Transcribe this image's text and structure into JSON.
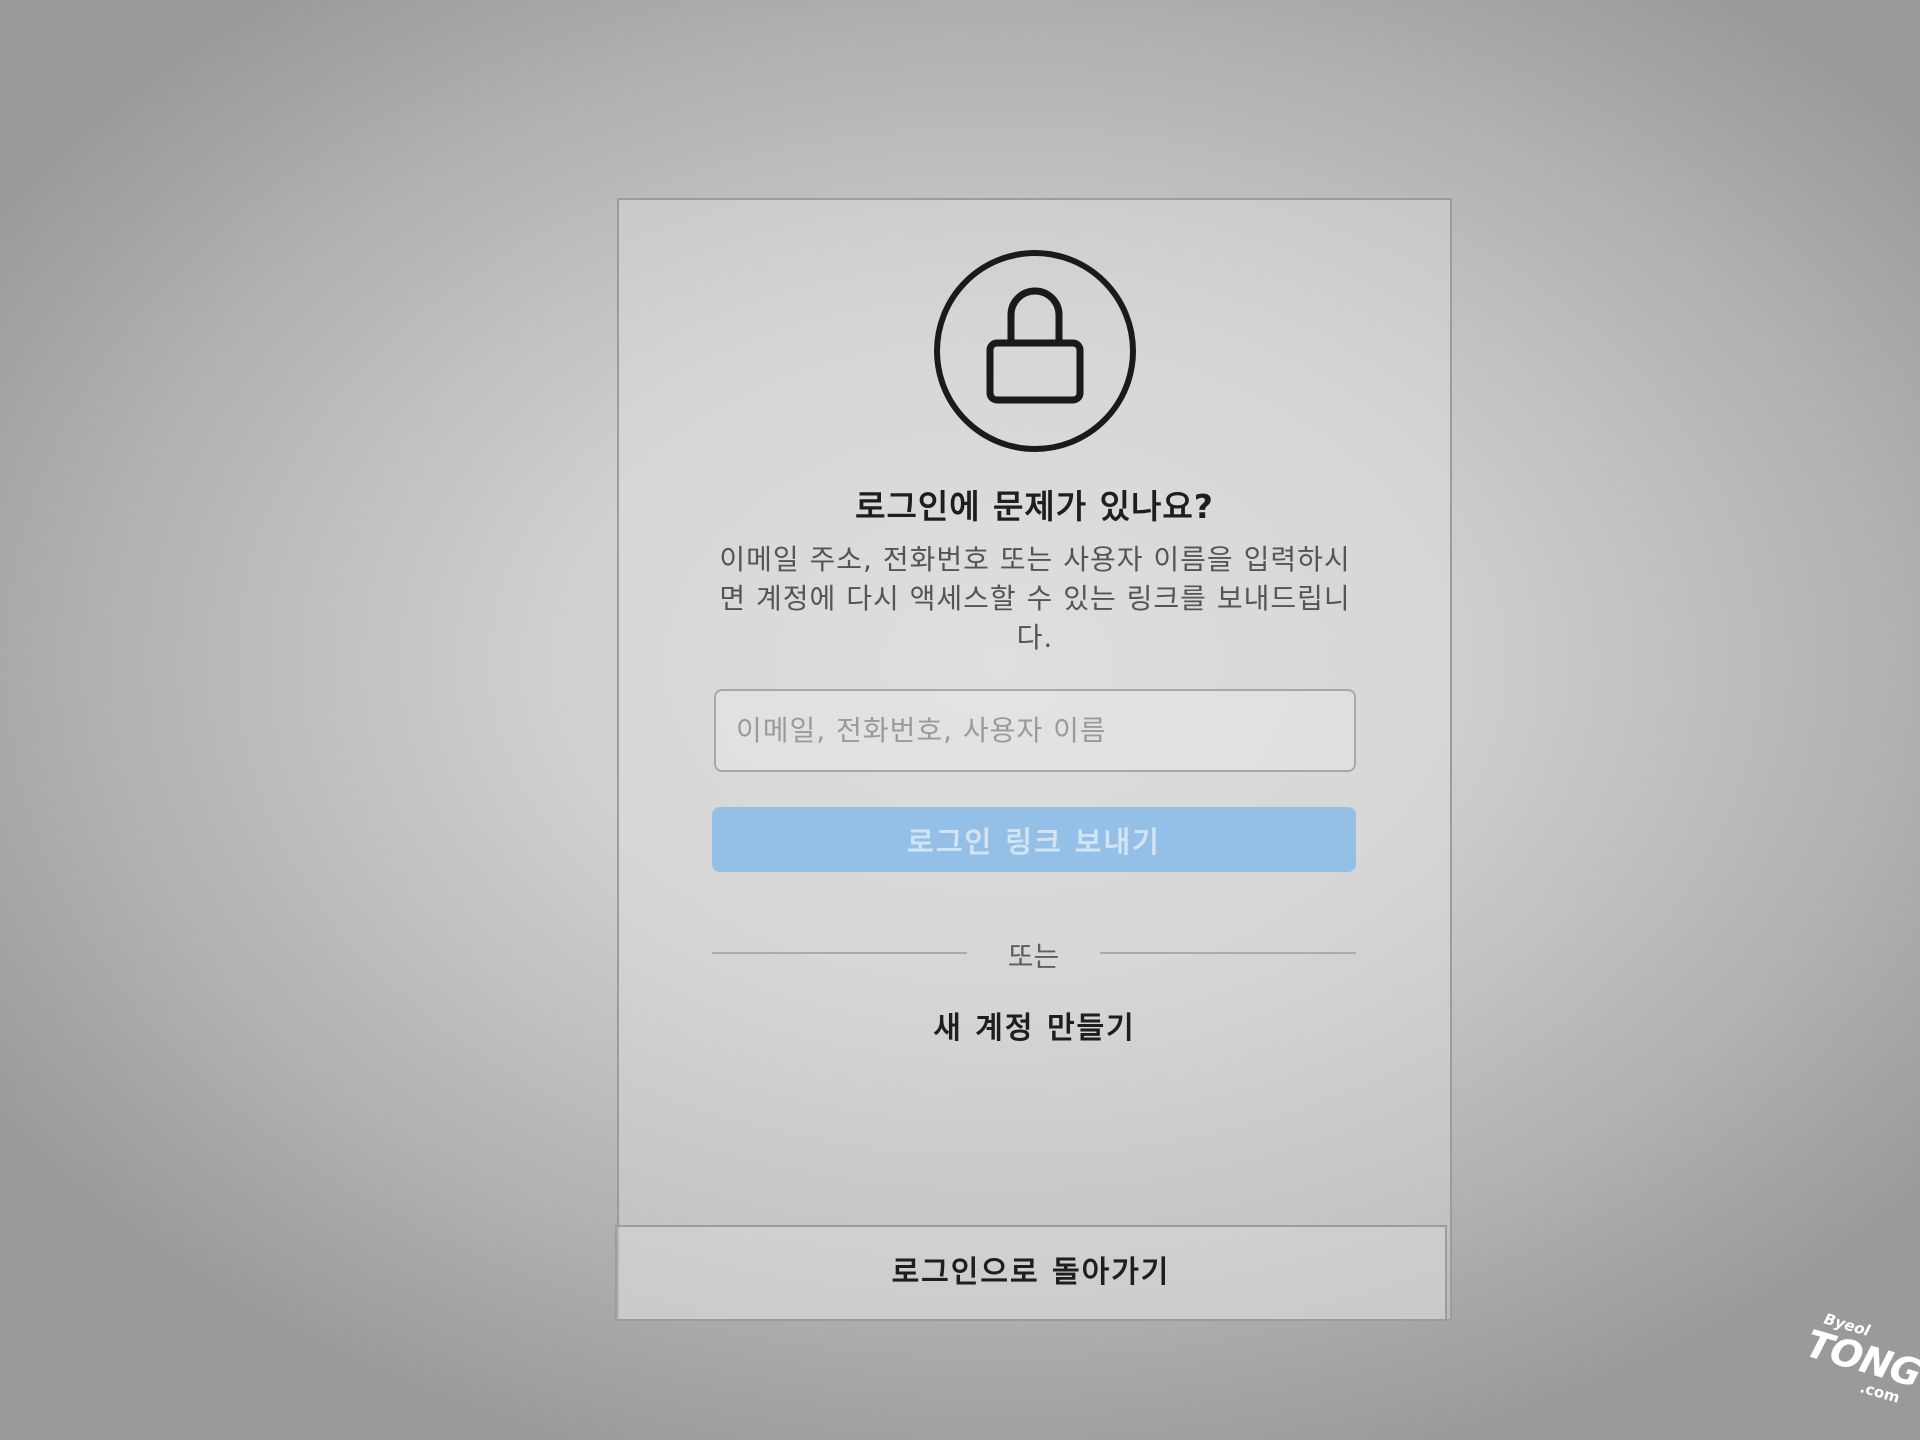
{
  "dialog": {
    "icon": "lock-icon",
    "title": "로그인에 문제가 있나요?",
    "description": "이메일 주소, 전화번호 또는 사용자 이름을 입력하시면 계정에 다시 액세스할 수 있는 링크를 보내드립니다.",
    "identifier_input": {
      "placeholder": "이메일, 전화번호, 사용자 이름",
      "value": ""
    },
    "send_login_link_label": "로그인 링크 보내기",
    "divider_text": "또는",
    "create_account_label": "새 계정 만들기",
    "back_to_login_label": "로그인으로 돌아가기"
  },
  "watermark": {
    "top": "Byeol",
    "main": "TONG",
    "domain": ".com"
  },
  "colors": {
    "primary_button_disabled": "#94bfe6",
    "primary_button_text": "#d2e4f3",
    "text_dark": "#1e1e1e",
    "text_muted": "#555555",
    "border": "#9c9c9c"
  }
}
